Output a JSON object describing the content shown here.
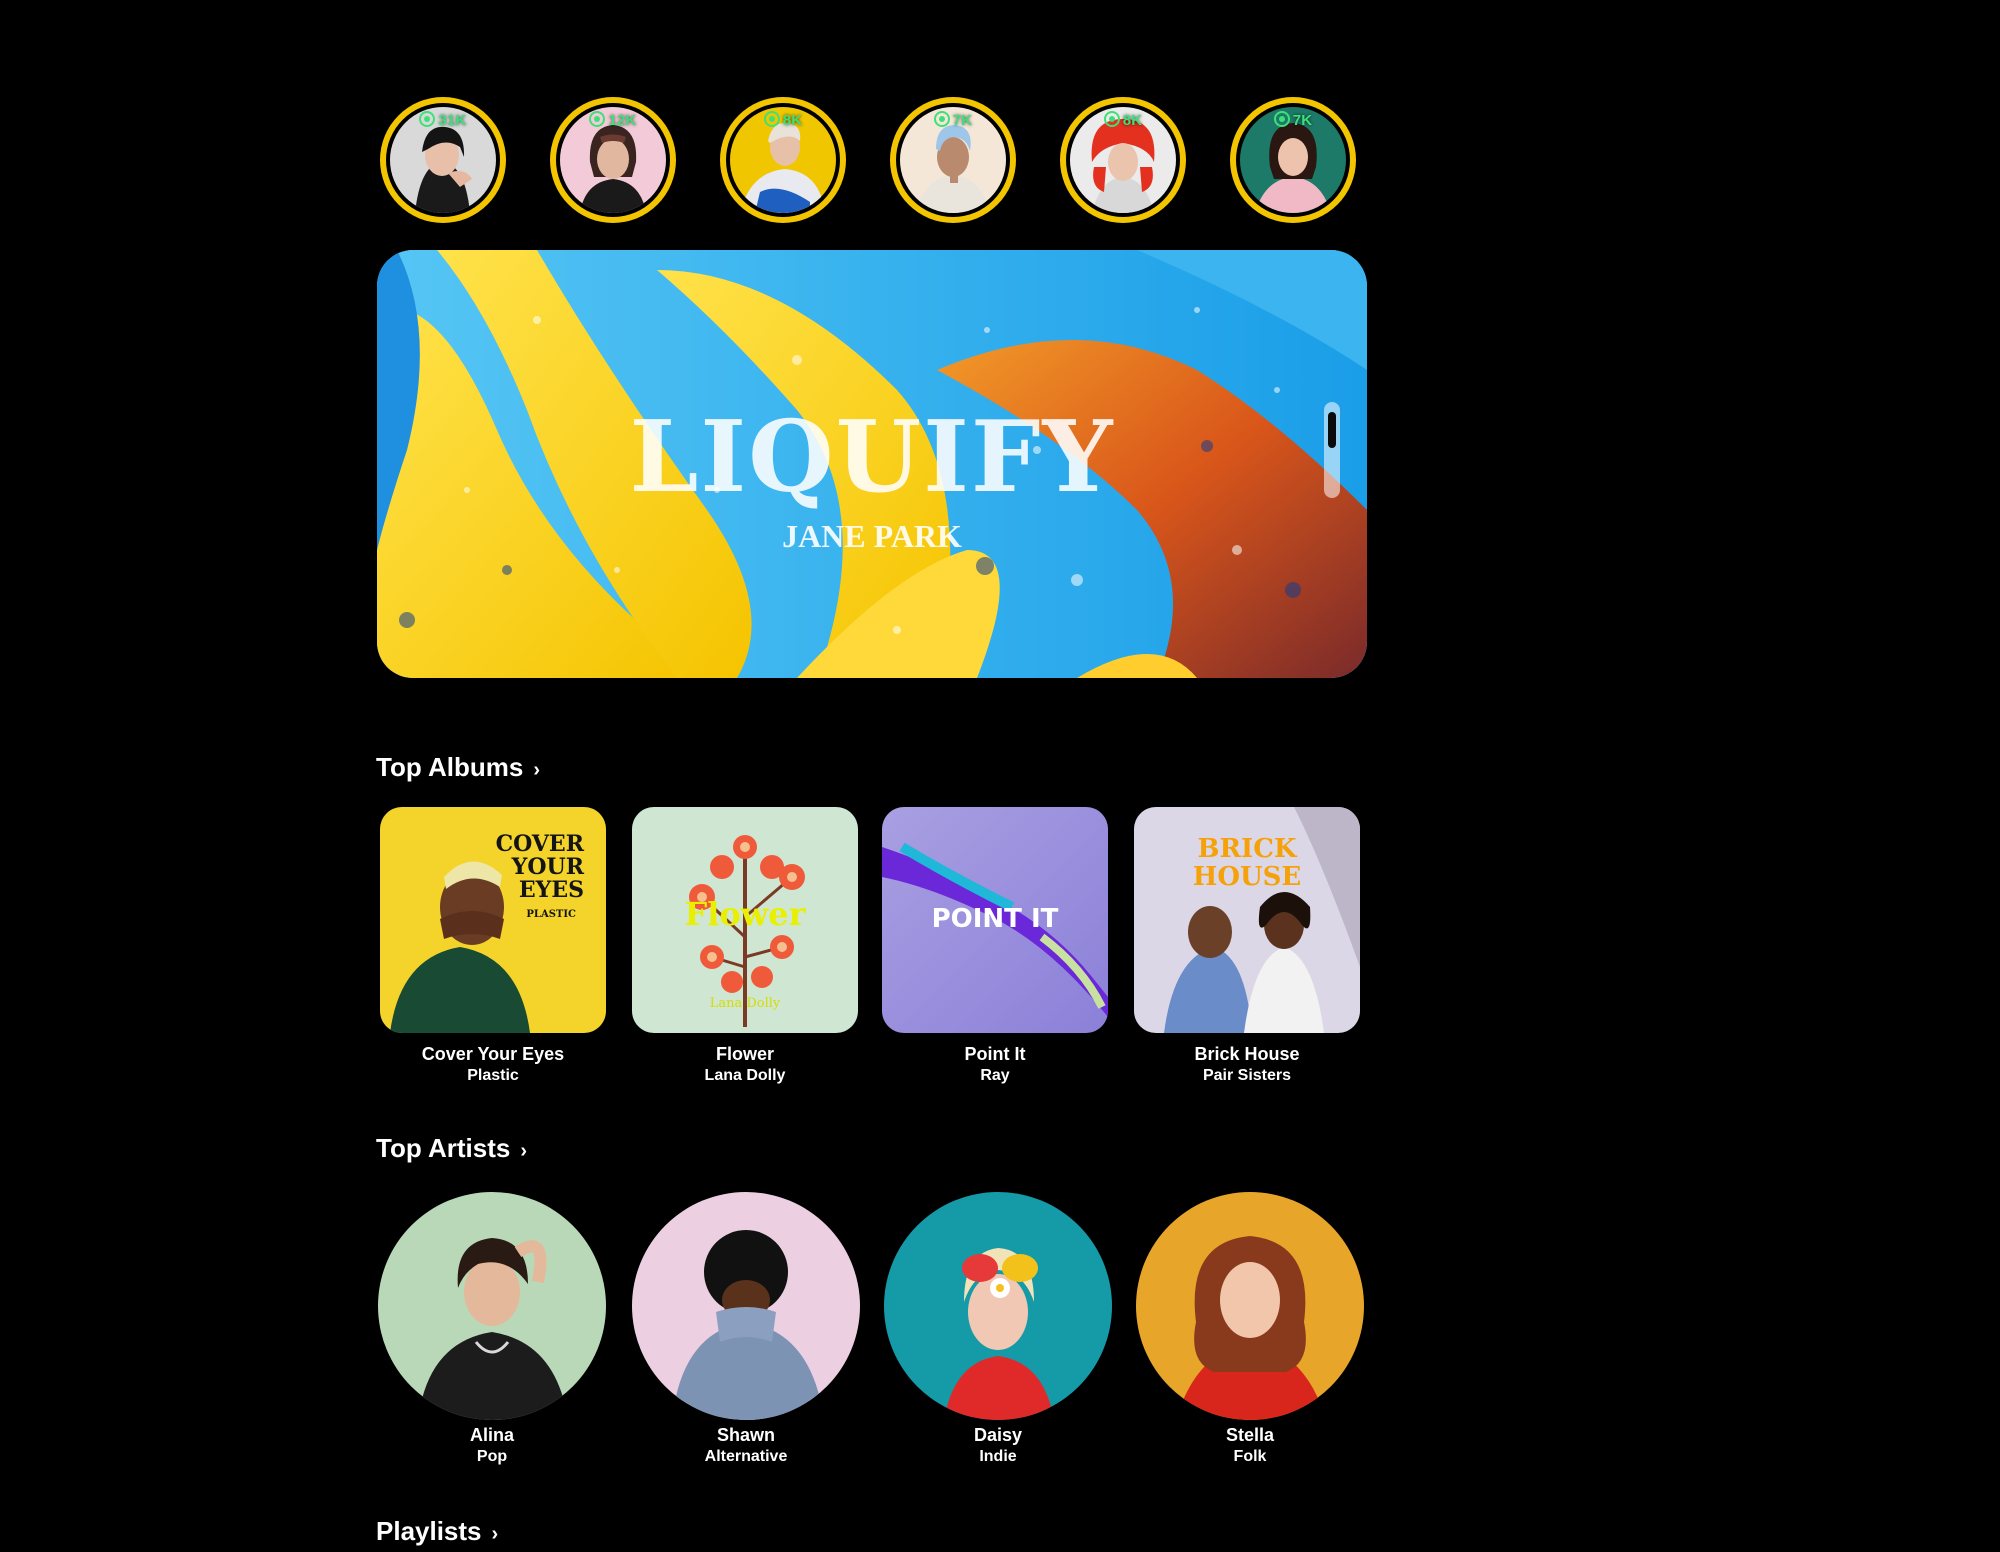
{
  "stories": [
    {
      "views": "31K"
    },
    {
      "views": "12K"
    },
    {
      "views": "8K"
    },
    {
      "views": "7K"
    },
    {
      "views": "8K"
    },
    {
      "views": "7K"
    }
  ],
  "hero": {
    "title": "LIQUIFY",
    "artist": "JANE PARK"
  },
  "sections": {
    "albums_title": "Top Albums",
    "albums_arrow": "›",
    "artists_title": "Top Artists",
    "artists_arrow": "›",
    "playlists_title": "Playlists",
    "playlists_arrow": "›"
  },
  "albums": [
    {
      "cover_line1": "COVER",
      "cover_line2": "YOUR",
      "cover_line3": "EYES",
      "cover_sub": "PLASTIC",
      "name": "Cover Your Eyes",
      "artist": "Plastic"
    },
    {
      "cover_line1": "Flower",
      "cover_sub": "Lana Dolly",
      "name": "Flower",
      "artist": "Lana Dolly"
    },
    {
      "cover_line1": "POINT IT",
      "name": "Point It",
      "artist": "Ray"
    },
    {
      "cover_line1": "BRICK",
      "cover_line2": "HOUSE",
      "name": "Brick House",
      "artist": "Pair Sisters"
    }
  ],
  "artists": [
    {
      "name": "Alina",
      "genre": "Pop"
    },
    {
      "name": "Shawn",
      "genre": "Alternative"
    },
    {
      "name": "Daisy",
      "genre": "Indie"
    },
    {
      "name": "Stella",
      "genre": "Folk"
    }
  ],
  "colors": {
    "story_ring": "#f2c500",
    "views": "#3ee07a",
    "background": "#000000"
  }
}
